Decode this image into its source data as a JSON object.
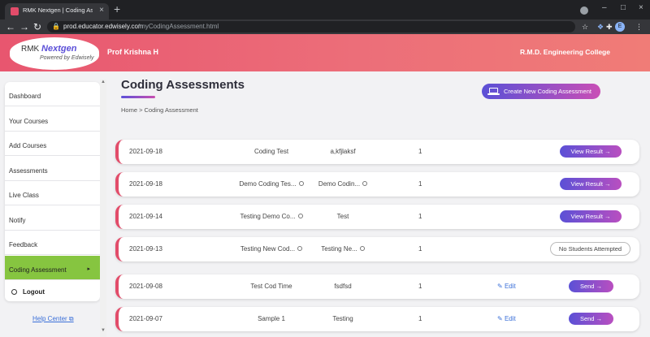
{
  "browser": {
    "tab_title": "RMK Nextgen | Coding Assessm",
    "tab_close_glyph": "×",
    "new_tab_glyph": "+",
    "url_host": "prod.educator.edwisely.com",
    "url_path": "/myCodingAssessment.html",
    "nav_glyphs": {
      "back": "←",
      "forward": "→",
      "reload": "↻"
    },
    "lock_glyph": "🔒",
    "window_controls": {
      "minimize": "–",
      "maximize": "□",
      "close": "×"
    },
    "toolbar_icons": {
      "star": "☆",
      "extension": "❖",
      "puzzle": "✚",
      "profile": "E",
      "menu": "⋮"
    }
  },
  "header": {
    "logo_prefix": "RMK",
    "logo_brand": "Nextgen",
    "logo_tagline": "Powered by Edwisely",
    "teacher_name": "Prof Krishna H",
    "college_name": "R.M.D. Engineering College",
    "colors": {
      "gradient_start": "#e8566f",
      "gradient_end": "#f07c77"
    }
  },
  "sidebar": {
    "items": [
      {
        "label": "Dashboard"
      },
      {
        "label": "Your Courses"
      },
      {
        "label": "Add Courses"
      },
      {
        "label": "Assessments"
      },
      {
        "label": "Live Class"
      },
      {
        "label": "Notify"
      },
      {
        "label": "Feedback"
      },
      {
        "label": "Coding Assessment",
        "active": true,
        "arrow": "▸"
      }
    ],
    "logout_label": "Logout",
    "help_label": "Help Center",
    "help_icon": "⧉",
    "scroll_up": "▲",
    "scroll_down": "▼",
    "active_color": "#86c540"
  },
  "main": {
    "title": "Coding Assessments",
    "breadcrumb": "Home > Coding Assessment",
    "create_button": "Create New Coding Assessment",
    "rows": [
      {
        "date": "2021-09-18",
        "name": "Coding Test",
        "language": "a,kfjlaksf",
        "count": "1",
        "action": "View Result →"
      },
      {
        "date": "2021-09-18",
        "name": "Demo Coding Tes...",
        "language": "Demo Codin...",
        "count": "1",
        "action": "View Result →"
      },
      {
        "date": "2021-09-14",
        "name": "Testing Demo Co...",
        "language": "Test",
        "count": "1",
        "action": "View Result →"
      },
      {
        "date": "2021-09-13",
        "name": "Testing New Cod...",
        "language": "Testing Ne...",
        "count": "1",
        "action": "No Students Attempted"
      },
      {
        "date": "2021-09-08",
        "name": "Test Cod Time",
        "language": "fsdfsd",
        "count": "1",
        "edit": "Edit",
        "action": "Send →"
      },
      {
        "date": "2021-09-07",
        "name": "Sample 1",
        "language": "Testing",
        "count": "1",
        "edit": "Edit",
        "action": "Send →"
      }
    ],
    "edit_icon": "✎",
    "colors": {
      "row_accent": "#e24c6a",
      "button_start": "#5b50d6",
      "button_end": "#b94fc0"
    }
  }
}
